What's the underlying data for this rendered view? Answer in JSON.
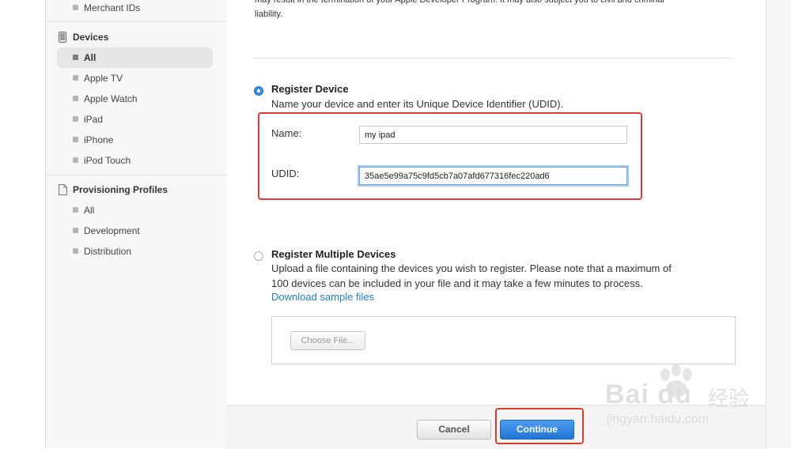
{
  "sidebar": {
    "items_top": [
      {
        "label": "Merchant IDs"
      }
    ],
    "devices": {
      "header": "Devices",
      "items": [
        {
          "label": "All",
          "active": true
        },
        {
          "label": "Apple TV"
        },
        {
          "label": "Apple Watch"
        },
        {
          "label": "iPad"
        },
        {
          "label": "iPhone"
        },
        {
          "label": "iPod Touch"
        }
      ]
    },
    "profiles": {
      "header": "Provisioning Profiles",
      "items": [
        {
          "label": "All"
        },
        {
          "label": "Development"
        },
        {
          "label": "Distribution"
        }
      ]
    }
  },
  "main": {
    "top_text_line1": "may result in the termination of your Apple Developer Program. It may also subject you to civil and criminal",
    "top_text_line2": "liability.",
    "register_device": {
      "title": "Register Device",
      "description": "Name your device and enter its Unique Device Identifier (UDID).",
      "name_label": "Name:",
      "name_value": "my ipad",
      "udid_label": "UDID:",
      "udid_value": "35ae5e99a75c9fd5cb7a07afd677316fec220ad6",
      "selected": true
    },
    "register_multiple": {
      "title": "Register Multiple Devices",
      "description_line1": "Upload a file containing the devices you wish to register. Please note that a maximum of",
      "description_line2": "100 devices can be included in your file and it may take a few minutes to process.",
      "link": "Download sample files",
      "choose_file": "Choose File..."
    }
  },
  "footer": {
    "cancel": "Cancel",
    "continue": "Continue"
  },
  "watermark": {
    "brand": "Bai du",
    "brand_cn": "经验",
    "url": "jingyan.baidu.com"
  },
  "colors": {
    "accent": "#2474d6",
    "highlight_box": "#e03b2e",
    "link": "#1a7fd1"
  }
}
